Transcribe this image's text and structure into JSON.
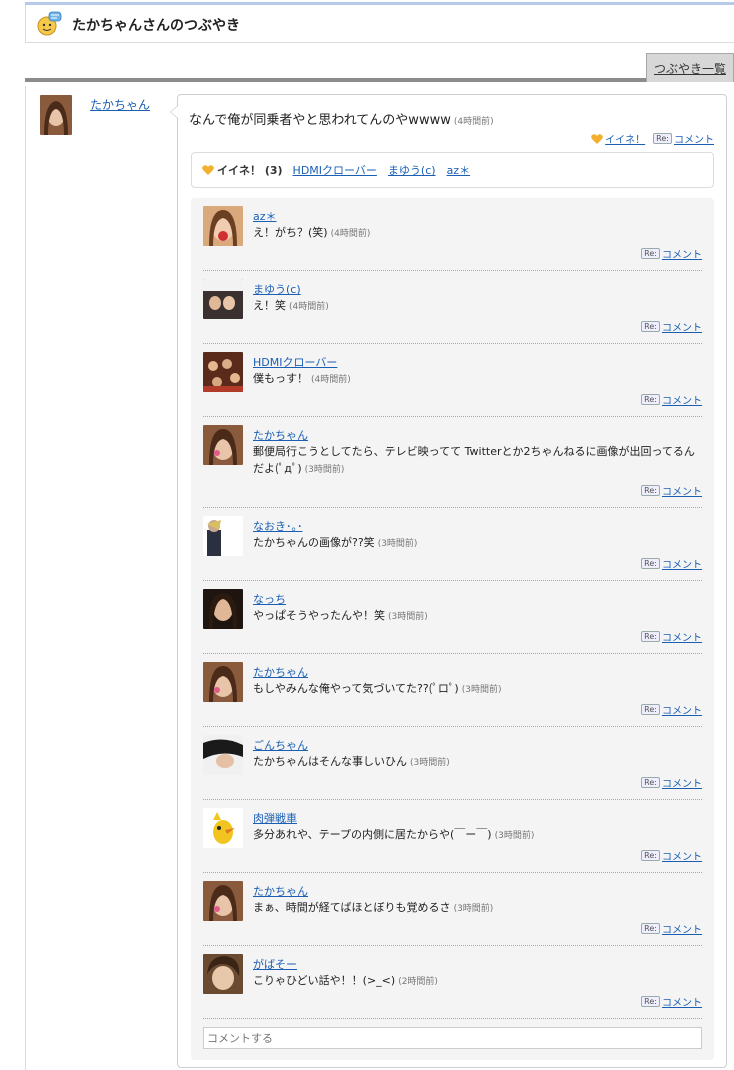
{
  "header": {
    "title": "たかちゃんさんのつぶやき"
  },
  "tabs": {
    "list_label": "つぶやき一覧"
  },
  "post": {
    "author": "たかちゃん",
    "text": "なんで俺が同乗者やと思われてんのやwwww",
    "time": "(4時間前)",
    "like_label": "イイネ！",
    "comment_label": "コメント"
  },
  "likes": {
    "label": "イイネ！ (3)",
    "users": [
      "HDMIクローバー",
      "まゆう(c)",
      "az＊"
    ]
  },
  "comments": [
    {
      "name": "az＊",
      "text": "え！がち？(笑)",
      "time": "(4時間前)",
      "reply": "コメント"
    },
    {
      "name": "まゆう(c)",
      "text": "え！笑",
      "time": "(4時間前)",
      "reply": "コメント"
    },
    {
      "name": "HDMIクローバー",
      "text": "僕もっす！",
      "time": "(4時間前)",
      "reply": "コメント"
    },
    {
      "name": "たかちゃん",
      "text": "郵便局行こうとしてたら、テレビ映ってて Twitterとか2ちゃんねるに画像が出回ってるんだよ(ﾟдﾟ)",
      "time": "(3時間前)",
      "reply": "コメント"
    },
    {
      "name": "なおき･｡･",
      "text": "たかちゃんの画像が??笑",
      "time": "(3時間前)",
      "reply": "コメント"
    },
    {
      "name": "なっち",
      "text": "やっぱそうやったんや！笑",
      "time": "(3時間前)",
      "reply": "コメント"
    },
    {
      "name": "たかちゃん",
      "text": "もしやみんな俺やって気づいてた??(ﾟロﾟ)",
      "time": "(3時間前)",
      "reply": "コメント"
    },
    {
      "name": "ごんちゃん",
      "text": "たかちゃんはそんな事しいひん",
      "time": "(3時間前)",
      "reply": "コメント"
    },
    {
      "name": "肉弾戦車",
      "text": "多分あれや、テープの内側に居たからや(￣ー￣)",
      "time": "(3時間前)",
      "reply": "コメント"
    },
    {
      "name": "たかちゃん",
      "text": "まぁ、時間が経てばほとぼりも覚めるさ",
      "time": "(3時間前)",
      "reply": "コメント"
    },
    {
      "name": "がばそー",
      "text": "こりゃひどい話や！！(>_<)",
      "time": "(2時間前)",
      "reply": "コメント"
    }
  ],
  "comment_input": {
    "placeholder": "コメントする"
  },
  "colors": {
    "link": "#1a5fb4",
    "panel_bg": "#f4f4f4",
    "tab_bg": "#d7d7d7"
  }
}
